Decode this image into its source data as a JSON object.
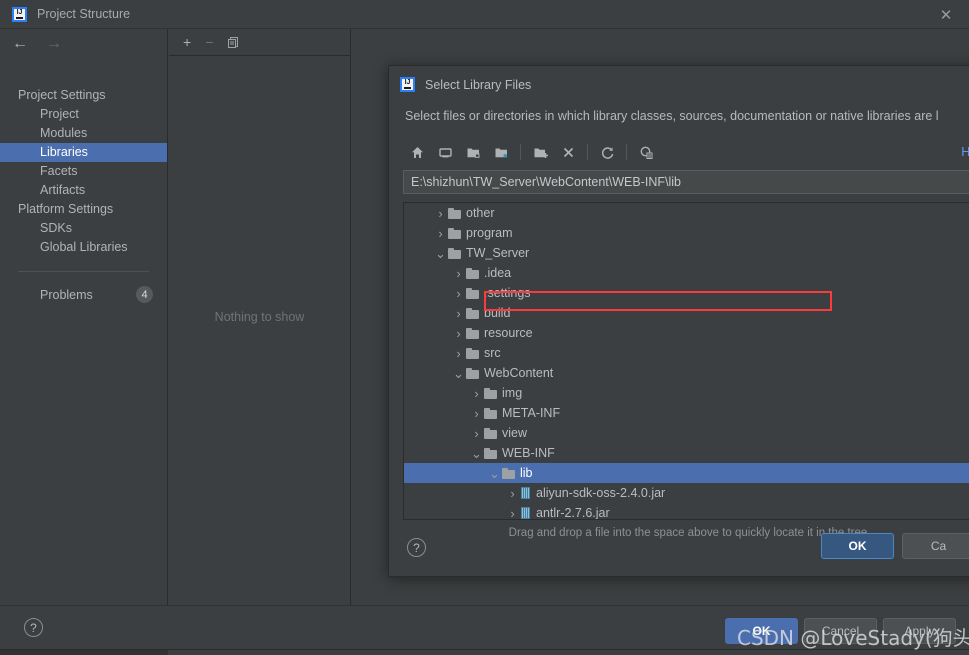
{
  "window": {
    "title": "Project Structure",
    "logo_icon": "intellij-idea-logo-icon",
    "close_icon": "close-icon",
    "back_icon": "back-arrow-icon",
    "forward_icon": "forward-arrow-icon"
  },
  "sidebar": {
    "groups": [
      {
        "label": "Project Settings",
        "items": [
          "Project",
          "Modules",
          "Libraries",
          "Facets",
          "Artifacts"
        ]
      },
      {
        "label": "Platform Settings",
        "items": [
          "SDKs",
          "Global Libraries"
        ]
      }
    ],
    "selected": "Libraries",
    "problems": {
      "label": "Problems",
      "count": "4"
    }
  },
  "center_panel": {
    "toolbar": [
      {
        "name": "add-button",
        "glyph": "+"
      },
      {
        "name": "remove-button",
        "glyph": "−"
      },
      {
        "name": "copy-button",
        "glyph": "❐"
      }
    ],
    "empty_text": "Nothing to show"
  },
  "window_buttons": {
    "ok": "OK",
    "cancel": "Cancel",
    "apply": "Apply",
    "help": "?"
  },
  "dialog": {
    "title": "Select Library Files",
    "logo_icon": "intellij-idea-logo-icon",
    "description": "Select files or directories in which library classes, sources, documentation or native libraries are l",
    "hide_link": "Hi",
    "path_value": "E:\\shizhun\\TW_Server\\WebContent\\WEB-INF\\lib",
    "toolbar": [
      {
        "name": "home-icon",
        "title": "Home"
      },
      {
        "name": "desktop-icon",
        "title": "Desktop"
      },
      {
        "name": "project-folder-icon",
        "title": "Project"
      },
      {
        "name": "module-folder-icon",
        "title": "Module"
      },
      {
        "name": "new-folder-icon",
        "title": "New Folder"
      },
      {
        "name": "delete-icon",
        "title": "Delete"
      },
      {
        "name": "refresh-icon",
        "title": "Refresh"
      },
      {
        "name": "show-hidden-icon",
        "title": "Show Hidden Files"
      }
    ],
    "tree": [
      {
        "label": "other",
        "depth": 1,
        "type": "folder",
        "state": "collapsed"
      },
      {
        "label": "program",
        "depth": 1,
        "type": "folder",
        "state": "collapsed"
      },
      {
        "label": "TW_Server",
        "depth": 1,
        "type": "folder",
        "state": "expanded"
      },
      {
        "label": ".idea",
        "depth": 2,
        "type": "folder",
        "state": "collapsed"
      },
      {
        "label": ".settings",
        "depth": 2,
        "type": "folder",
        "state": "collapsed"
      },
      {
        "label": "build",
        "depth": 2,
        "type": "folder",
        "state": "collapsed"
      },
      {
        "label": "resource",
        "depth": 2,
        "type": "folder",
        "state": "collapsed"
      },
      {
        "label": "src",
        "depth": 2,
        "type": "folder",
        "state": "collapsed"
      },
      {
        "label": "WebContent",
        "depth": 2,
        "type": "folder",
        "state": "expanded"
      },
      {
        "label": "img",
        "depth": 3,
        "type": "folder",
        "state": "collapsed"
      },
      {
        "label": "META-INF",
        "depth": 3,
        "type": "folder",
        "state": "collapsed"
      },
      {
        "label": "view",
        "depth": 3,
        "type": "folder",
        "state": "collapsed"
      },
      {
        "label": "WEB-INF",
        "depth": 3,
        "type": "folder",
        "state": "expanded"
      },
      {
        "label": "lib",
        "depth": 4,
        "type": "folder",
        "state": "expanded",
        "selected": true
      },
      {
        "label": "aliyun-sdk-oss-2.4.0.jar",
        "depth": 5,
        "type": "jar",
        "state": "collapsed"
      },
      {
        "label": "antlr-2.7.6.jar",
        "depth": 5,
        "type": "jar",
        "state": "collapsed"
      }
    ],
    "hint": "Drag and drop a file into the space above to quickly locate it in the tree",
    "buttons": {
      "help": "?",
      "ok": "OK",
      "cancel": "Ca"
    }
  },
  "annotation": {
    "highlight_color": "#fa3c3c"
  },
  "watermark": {
    "text": "CSDN @LoveStady(狗头)"
  },
  "colors": {
    "background": "#3c3f41",
    "selection_blue": "#4b6eaf",
    "link_blue": "#589df6",
    "primary_button": "#365880"
  }
}
